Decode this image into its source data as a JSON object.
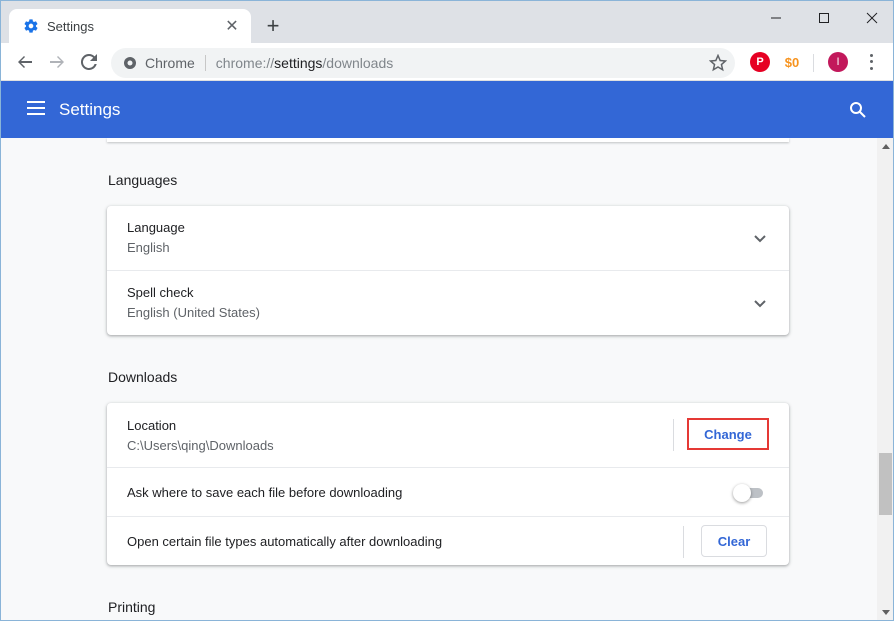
{
  "browser": {
    "tab_title": "Settings",
    "omnibox_chip": "Chrome",
    "url_prefix": "chrome://",
    "url_host": "settings",
    "url_path": "/downloads",
    "avatar_letter": "I",
    "extensions": [
      "pinterest-icon",
      "honey-icon"
    ],
    "window_controls": [
      "minimize-icon",
      "maximize-icon",
      "close-icon"
    ]
  },
  "header": {
    "title": "Settings",
    "search_icon": "search-icon",
    "menu_icon": "hamburger-icon",
    "color": "#3367d6"
  },
  "languages": {
    "section_title": "Languages",
    "rows": [
      {
        "label": "Language",
        "value": "English"
      },
      {
        "label": "Spell check",
        "value": "English (United States)"
      }
    ]
  },
  "downloads": {
    "section_title": "Downloads",
    "location": {
      "label": "Location",
      "value": "C:\\Users\\qing\\Downloads",
      "button": "Change"
    },
    "ask_where": {
      "label": "Ask where to save each file before downloading",
      "enabled": false
    },
    "auto_open": {
      "label": "Open certain file types automatically after downloading",
      "button": "Clear"
    }
  },
  "printing": {
    "section_title": "Printing"
  },
  "colors": {
    "accent": "#3367d6",
    "highlight": "#e53935"
  }
}
